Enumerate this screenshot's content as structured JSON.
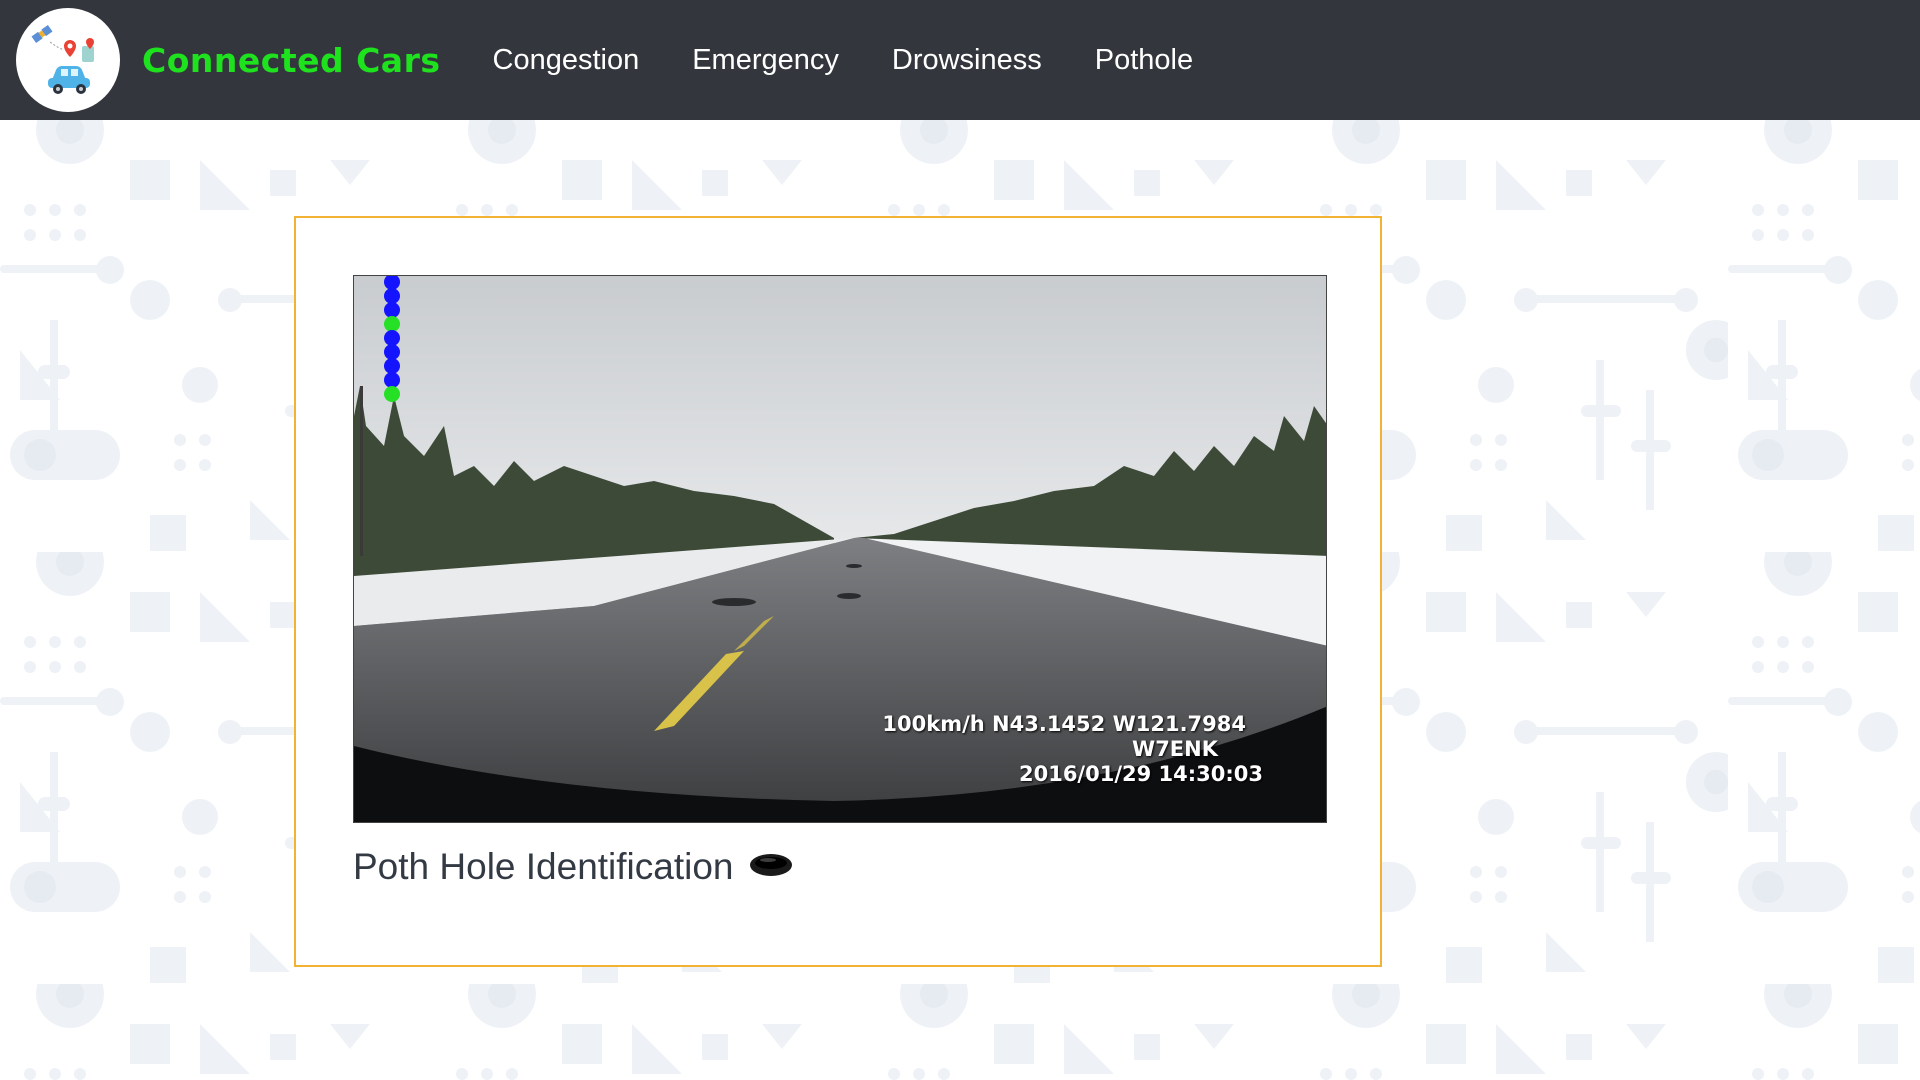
{
  "navbar": {
    "brand": "Connected Cars",
    "links": [
      {
        "label": "Congestion"
      },
      {
        "label": "Emergency"
      },
      {
        "label": "Drowsiness"
      },
      {
        "label": "Pothole"
      }
    ],
    "background_color": "#33373d",
    "brand_color": "#1ee21e"
  },
  "logo": {
    "icon": "connected-car-logo-icon"
  },
  "card": {
    "border_color": "#f2b233",
    "video": {
      "overlay": {
        "line1": "100km/h N43.1452 W121.7984",
        "line2": "W7ENK",
        "line3": "2016/01/29 14:30:03"
      }
    },
    "caption": "Poth Hole Identification",
    "caption_icon": "pothole-icon"
  }
}
